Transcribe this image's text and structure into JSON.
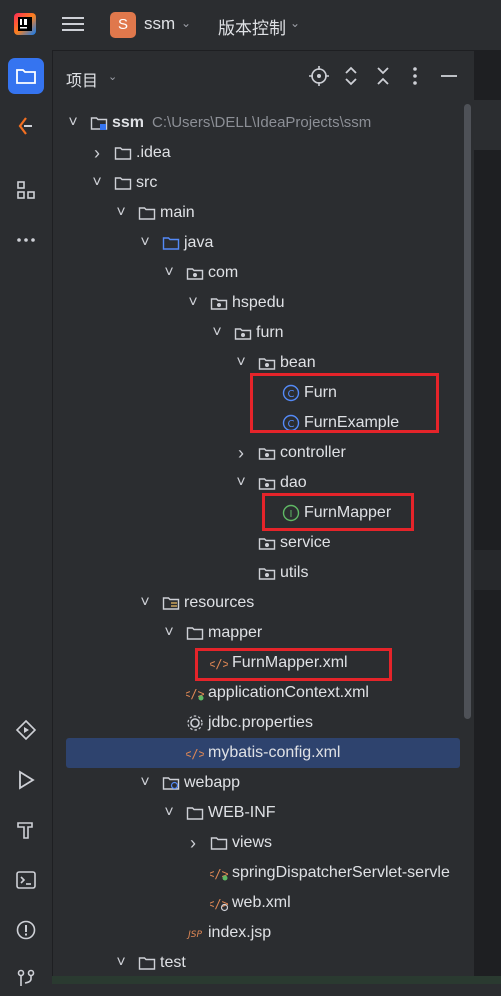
{
  "topbar": {
    "app_logo": "intellij-logo",
    "project_initial": "S",
    "project_name": "ssm",
    "vcs_label": "版本控制"
  },
  "panel": {
    "title": "项目"
  },
  "tree": [
    {
      "label": "ssm",
      "suffix": "C:\\Users\\DELL\\IdeaProjects\\ssm",
      "icon": "module-folder",
      "arrow": "down"
    },
    {
      "label": ".idea",
      "icon": "folder",
      "arrow": "right"
    },
    {
      "label": "src",
      "icon": "folder",
      "arrow": "down"
    },
    {
      "label": "main",
      "icon": "folder",
      "arrow": "down"
    },
    {
      "label": "java",
      "icon": "source-folder",
      "arrow": "down"
    },
    {
      "label": "com",
      "icon": "package",
      "arrow": "down"
    },
    {
      "label": "hspedu",
      "icon": "package",
      "arrow": "down"
    },
    {
      "label": "furn",
      "icon": "package",
      "arrow": "down"
    },
    {
      "label": "bean",
      "icon": "package",
      "arrow": "down"
    },
    {
      "label": "Furn",
      "icon": "class"
    },
    {
      "label": "FurnExample",
      "icon": "class"
    },
    {
      "label": "controller",
      "icon": "package",
      "arrow": "right"
    },
    {
      "label": "dao",
      "icon": "package",
      "arrow": "down"
    },
    {
      "label": "FurnMapper",
      "icon": "interface"
    },
    {
      "label": "service",
      "icon": "package"
    },
    {
      "label": "utils",
      "icon": "package"
    },
    {
      "label": "resources",
      "icon": "resources-folder",
      "arrow": "down"
    },
    {
      "label": "mapper",
      "icon": "folder",
      "arrow": "down"
    },
    {
      "label": "FurnMapper.xml",
      "icon": "xml"
    },
    {
      "label": "applicationContext.xml",
      "icon": "spring-xml"
    },
    {
      "label": "jdbc.properties",
      "icon": "properties"
    },
    {
      "label": "mybatis-config.xml",
      "icon": "xml"
    },
    {
      "label": "webapp",
      "icon": "web-folder",
      "arrow": "down"
    },
    {
      "label": "WEB-INF",
      "icon": "folder",
      "arrow": "down"
    },
    {
      "label": "views",
      "icon": "folder",
      "arrow": "right"
    },
    {
      "label": "springDispatcherServlet-servle",
      "icon": "spring-xml"
    },
    {
      "label": "web.xml",
      "icon": "web-xml"
    },
    {
      "label": "index.jsp",
      "icon": "jsp"
    },
    {
      "label": "test",
      "icon": "folder",
      "arrow": "down"
    }
  ],
  "colors": {
    "background": "#2b2d30",
    "selected_row": "#2e436e",
    "active_tool": "#3574f0",
    "highlight_box": "#e5242a",
    "class_icon": "#548af7",
    "interface_icon": "#5fb865",
    "xml_icon": "#e08855"
  }
}
